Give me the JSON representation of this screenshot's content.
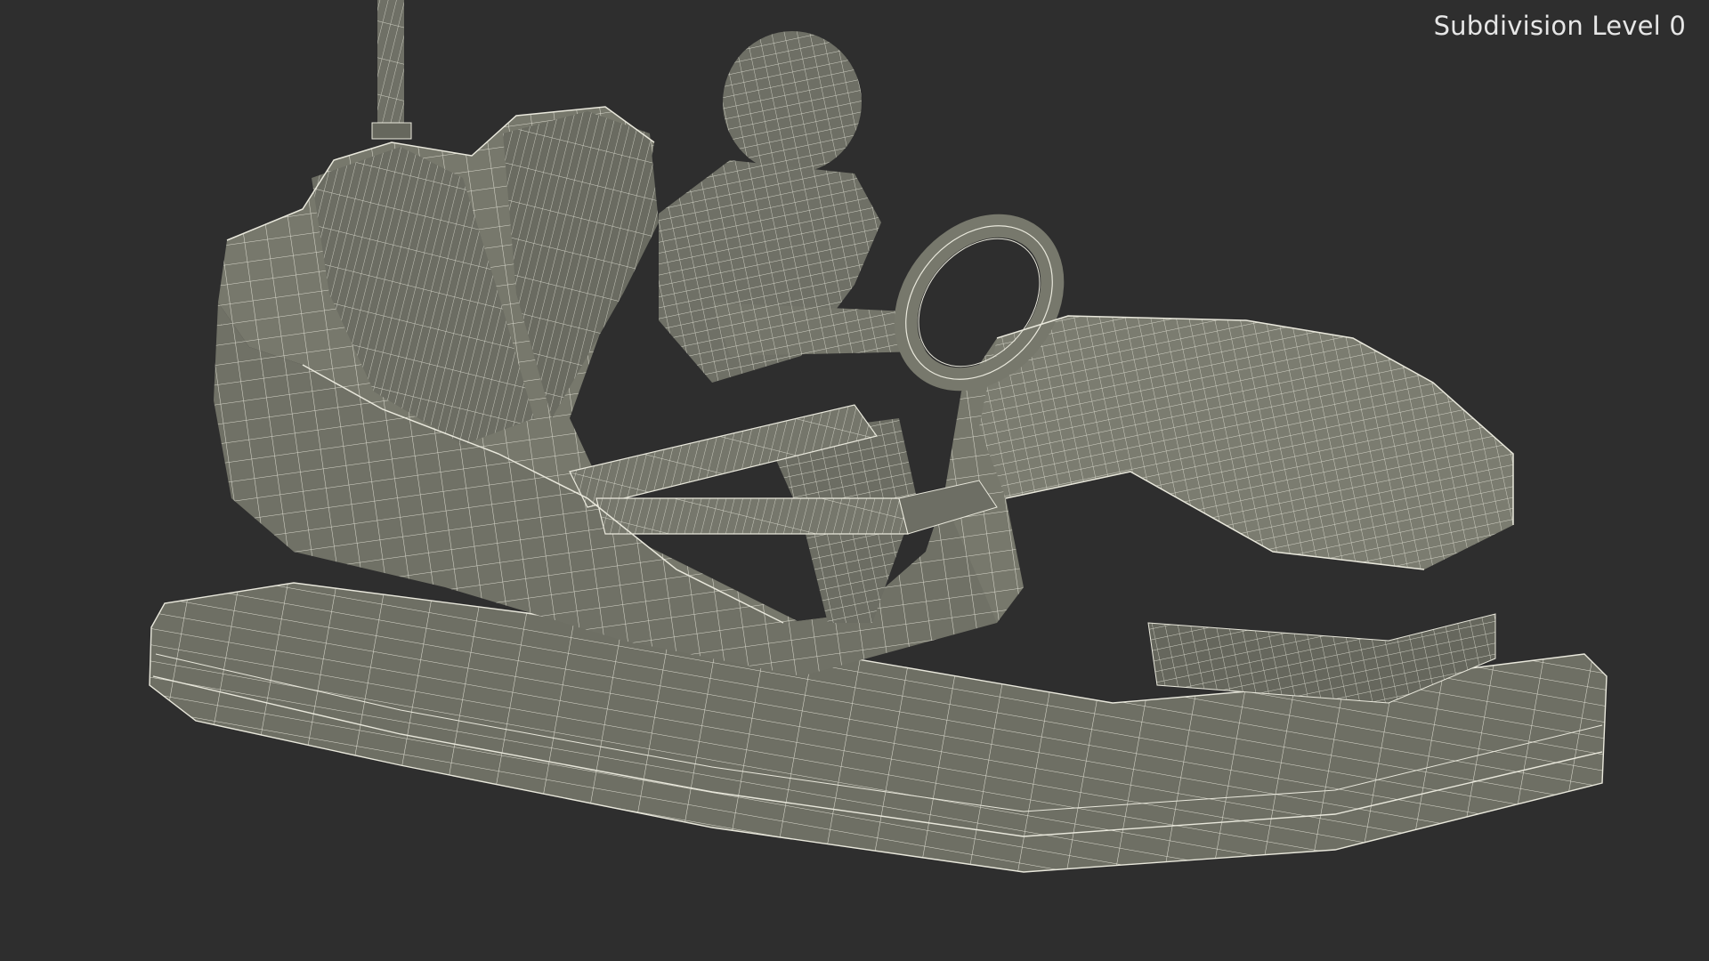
{
  "overlay": {
    "label": "Subdivision Level 0"
  },
  "render": {
    "background_color": "#2e2e2e",
    "surface_color": "#77786c",
    "surface_shade_color": "#5f6056",
    "wire_color": "#e9e8dc",
    "subject": "bumper-car-with-boy-wireframe"
  }
}
